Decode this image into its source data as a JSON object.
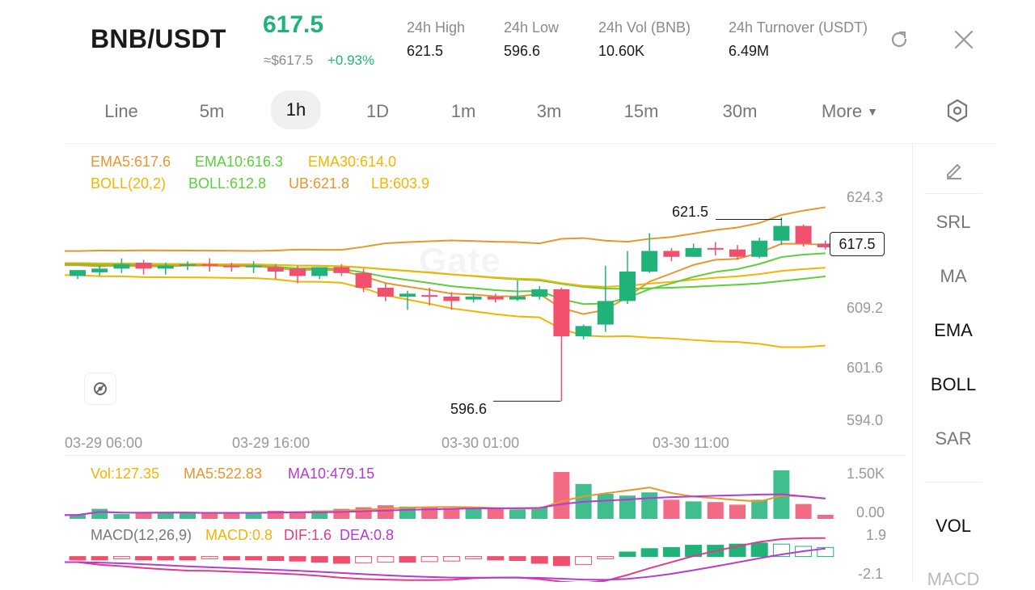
{
  "header": {
    "pair": "BNB/USDT",
    "price": "617.5",
    "usd_price": "≈$617.5",
    "change_pct": "+0.93%",
    "stats": [
      {
        "label": "24h  High",
        "value": "621.5"
      },
      {
        "label": "24h  Low",
        "value": "596.6"
      },
      {
        "label": "24h  Vol (BNB)",
        "value": "10.60K"
      },
      {
        "label": "24h  Turnover (USDT)",
        "value": "6.49M"
      }
    ]
  },
  "tabs": {
    "items": [
      "Line",
      "5m",
      "1h",
      "1D",
      "1m",
      "3m",
      "15m",
      "30m"
    ],
    "more": "More",
    "active": "1h"
  },
  "indicators_legend": {
    "ema5": "EMA5:617.6",
    "ema10": "EMA10:616.3",
    "ema30": "EMA30:614.0",
    "boll_params": "BOLL(20,2)",
    "boll": "BOLL:612.8",
    "ub": "UB:621.8",
    "lb": "LB:603.9"
  },
  "price_axis": [
    "624.3",
    "609.2",
    "601.6",
    "594.0"
  ],
  "current_price_tag": "617.5",
  "high_marker": "621.5",
  "low_marker": "596.6",
  "time_axis": [
    "03-29 06:00",
    "03-29 16:00",
    "03-30 01:00",
    "03-30 11:00"
  ],
  "volume_legend": {
    "vol": "Vol:127.35",
    "ma5": "MA5:522.83",
    "ma10": "MA10:479.15",
    "axis_top": "1.50K",
    "axis_bottom": "0.00"
  },
  "macd_legend": {
    "params": "MACD(12,26,9)",
    "macd": "MACD:0.8",
    "dif": "DIF:1.6",
    "dea": "DEA:0.8",
    "axis_top": "1.9",
    "axis_bottom": "-2.1"
  },
  "side_panel": {
    "items": [
      "SRL",
      "MA",
      "EMA",
      "BOLL",
      "SAR"
    ],
    "active": [
      "EMA",
      "BOLL"
    ],
    "sub_items": [
      "VOL",
      "MACD"
    ],
    "sub_active": [
      "VOL"
    ]
  },
  "colors": {
    "up": "#1fb37a",
    "down": "#f0506e",
    "ema5": "#e8962e",
    "ema10": "#5ccf3a",
    "ema30": "#f5b400",
    "boll_mid": "#5ccf3a",
    "ub": "#e8962e",
    "lb": "#f5b400",
    "ma10": "#b43bd6"
  },
  "chart_data": {
    "type": "candlestick",
    "interval": "1h",
    "price_ylim": [
      594.0,
      624.3
    ],
    "candles": [
      {
        "o": 613.6,
        "h": 614.0,
        "c": 614.4,
        "l": 613.2
      },
      {
        "o": 614.1,
        "h": 615.0,
        "c": 614.6,
        "l": 613.6
      },
      {
        "o": 614.6,
        "h": 616.0,
        "c": 615.2,
        "l": 614.0
      },
      {
        "o": 615.4,
        "h": 615.8,
        "c": 614.6,
        "l": 613.8
      },
      {
        "o": 614.6,
        "h": 615.4,
        "c": 615.0,
        "l": 613.8
      },
      {
        "o": 615.0,
        "h": 615.6,
        "c": 615.2,
        "l": 614.4
      },
      {
        "o": 615.2,
        "h": 616.0,
        "c": 615.0,
        "l": 614.2
      },
      {
        "o": 615.0,
        "h": 615.4,
        "c": 614.8,
        "l": 614.2
      },
      {
        "o": 614.8,
        "h": 615.6,
        "c": 615.0,
        "l": 614.0
      },
      {
        "o": 614.8,
        "h": 615.2,
        "c": 614.2,
        "l": 613.2
      },
      {
        "o": 614.6,
        "h": 615.0,
        "c": 613.6,
        "l": 612.6
      },
      {
        "o": 613.6,
        "h": 614.8,
        "c": 614.8,
        "l": 613.2
      },
      {
        "o": 614.8,
        "h": 615.2,
        "c": 614.0,
        "l": 613.6
      },
      {
        "o": 614.0,
        "h": 614.6,
        "c": 612.0,
        "l": 611.4
      },
      {
        "o": 612.0,
        "h": 612.6,
        "c": 610.8,
        "l": 610.2
      },
      {
        "o": 610.8,
        "h": 611.6,
        "c": 611.2,
        "l": 609.0
      },
      {
        "o": 611.0,
        "h": 612.0,
        "c": 610.8,
        "l": 609.6
      },
      {
        "o": 610.8,
        "h": 611.4,
        "c": 610.2,
        "l": 609.0
      },
      {
        "o": 610.4,
        "h": 611.2,
        "c": 610.8,
        "l": 610.0
      },
      {
        "o": 610.8,
        "h": 611.2,
        "c": 610.4,
        "l": 610.0
      },
      {
        "o": 610.4,
        "h": 613.0,
        "c": 610.8,
        "l": 610.2
      },
      {
        "o": 610.8,
        "h": 612.2,
        "c": 611.8,
        "l": 610.4
      },
      {
        "o": 611.8,
        "h": 612.0,
        "c": 605.4,
        "l": 596.6
      },
      {
        "o": 605.4,
        "h": 607.0,
        "c": 606.8,
        "l": 605.0
      },
      {
        "o": 607.0,
        "h": 615.0,
        "c": 610.2,
        "l": 606.0
      },
      {
        "o": 610.2,
        "h": 617.0,
        "c": 614.2,
        "l": 609.8
      },
      {
        "o": 614.2,
        "h": 619.4,
        "c": 617.0,
        "l": 614.0
      },
      {
        "o": 617.0,
        "h": 617.4,
        "c": 616.2,
        "l": 615.6
      },
      {
        "o": 616.2,
        "h": 618.0,
        "c": 617.4,
        "l": 616.2
      },
      {
        "o": 617.4,
        "h": 618.2,
        "c": 617.2,
        "l": 616.4
      },
      {
        "o": 617.2,
        "h": 617.8,
        "c": 616.2,
        "l": 615.8
      },
      {
        "o": 616.2,
        "h": 618.8,
        "c": 618.4,
        "l": 616.0
      },
      {
        "o": 618.4,
        "h": 621.5,
        "c": 620.4,
        "l": 617.8
      },
      {
        "o": 620.4,
        "h": 620.6,
        "c": 618.0,
        "l": 617.6
      },
      {
        "o": 618.0,
        "h": 618.4,
        "c": 617.5,
        "l": 617.2
      }
    ],
    "volumes": [
      120,
      310,
      150,
      180,
      210,
      160,
      180,
      190,
      200,
      250,
      230,
      260,
      310,
      360,
      420,
      380,
      350,
      330,
      320,
      300,
      290,
      360,
      1450,
      1080,
      780,
      720,
      820,
      590,
      540,
      520,
      440,
      590,
      1500,
      460,
      127
    ],
    "volume_ylim": [
      0,
      1500
    ],
    "macd_hist": [
      -0.3,
      -0.3,
      -0.2,
      -0.3,
      -0.3,
      -0.3,
      -0.2,
      -0.3,
      -0.3,
      -0.35,
      -0.4,
      -0.5,
      -0.6,
      -0.55,
      -0.5,
      -0.5,
      -0.45,
      -0.4,
      -0.2,
      -0.3,
      -0.35,
      -0.6,
      -0.8,
      -0.7,
      -0.2,
      0.4,
      0.7,
      0.8,
      1.0,
      1.0,
      1.1,
      1.2,
      1.1,
      0.9,
      0.8
    ],
    "macd_ylim": [
      -2.1,
      1.9
    ]
  }
}
